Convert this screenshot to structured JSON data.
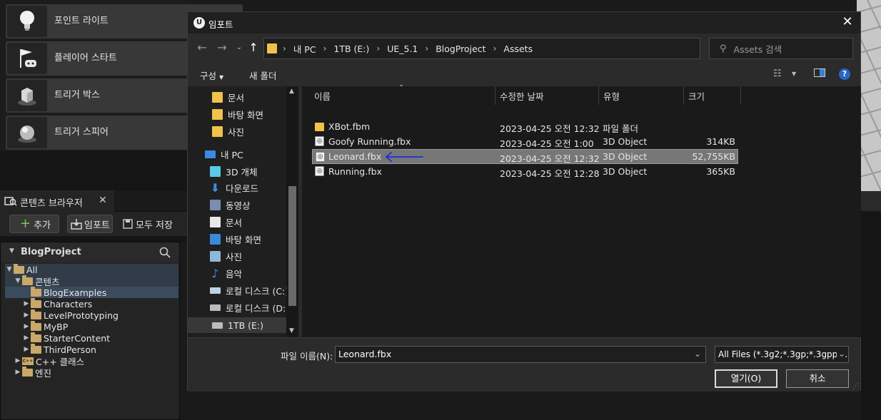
{
  "place_panel": {
    "items": [
      {
        "label": "포인트 라이트",
        "icon": "light-bulb-icon"
      },
      {
        "label": "플레이어 스타트",
        "icon": "player-start-icon"
      },
      {
        "label": "트리거 박스",
        "icon": "trigger-box-icon"
      },
      {
        "label": "트리거 스피어",
        "icon": "trigger-sphere-icon"
      }
    ]
  },
  "content_browser": {
    "tab_label": "콘텐츠 브라우저",
    "add_label": "추가",
    "import_label": "임포트",
    "save_all_label": "모두 저장",
    "tree_title": "BlogProject",
    "tree": [
      {
        "label": "All",
        "state": "expanded"
      },
      {
        "label": "콘텐츠",
        "state": "expanded"
      },
      {
        "label": "BlogExamples",
        "state": "selected"
      },
      {
        "label": "Characters",
        "state": "collapsed"
      },
      {
        "label": "LevelPrototyping",
        "state": "collapsed"
      },
      {
        "label": "MyBP",
        "state": "collapsed"
      },
      {
        "label": "StarterContent",
        "state": "collapsed"
      },
      {
        "label": "ThirdPerson",
        "state": "collapsed"
      },
      {
        "label": "C++ 클래스",
        "state": "collapsed"
      },
      {
        "label": "엔진",
        "state": "collapsed"
      }
    ],
    "cpp_badge": "C++"
  },
  "dialog": {
    "title": "임포트",
    "breadcrumb": [
      "내 PC",
      "1TB (E:)",
      "UE_5.1",
      "BlogProject",
      "Assets"
    ],
    "search_placeholder": "Assets 검색",
    "organize_label": "구성",
    "new_folder_label": "새 폴더",
    "nav": [
      {
        "label": "문서",
        "icon": "folder-icon"
      },
      {
        "label": "바탕 화면",
        "icon": "folder-icon"
      },
      {
        "label": "사진",
        "icon": "folder-icon"
      },
      {
        "label": "내 PC",
        "icon": "pc-icon"
      },
      {
        "label": "3D 개체",
        "icon": "3d-objects-icon"
      },
      {
        "label": "다운로드",
        "icon": "download-icon"
      },
      {
        "label": "동영상",
        "icon": "video-icon"
      },
      {
        "label": "문서",
        "icon": "document-icon"
      },
      {
        "label": "바탕 화면",
        "icon": "desktop-icon"
      },
      {
        "label": "사진",
        "icon": "pictures-icon"
      },
      {
        "label": "음악",
        "icon": "music-icon"
      },
      {
        "label": "로컬 디스크 (C:)",
        "icon": "drive-icon"
      },
      {
        "label": "로컬 디스크 (D:)",
        "icon": "drive-icon"
      },
      {
        "label": "1TB (E:)",
        "icon": "drive-icon",
        "selected": true
      }
    ],
    "columns": {
      "name": "이름",
      "date": "수정한 날짜",
      "type": "유형",
      "size": "크기"
    },
    "files": [
      {
        "name": "XBot.fbm",
        "date": "2023-04-25 오전 12:32",
        "type": "파일 폴더",
        "size": "",
        "kind": "folder"
      },
      {
        "name": "Goofy Running.fbx",
        "date": "2023-04-25 오전 1:00",
        "type": "3D Object",
        "size": "314KB",
        "kind": "file"
      },
      {
        "name": "Leonard.fbx",
        "date": "2023-04-25 오전 12:32",
        "type": "3D Object",
        "size": "52,755KB",
        "kind": "file",
        "selected": true
      },
      {
        "name": "Running.fbx",
        "date": "2023-04-25 오전 12:28",
        "type": "3D Object",
        "size": "365KB",
        "kind": "file"
      }
    ],
    "filename_label": "파일 이름(N):",
    "filename_value": "Leonard.fbx",
    "filetype_value": "All Files (*.3g2;*.3gp;*.3gpp;*.3",
    "open_label": "열기(O)",
    "cancel_label": "취소",
    "annotation_arrow_color": "#1a2fd6"
  }
}
